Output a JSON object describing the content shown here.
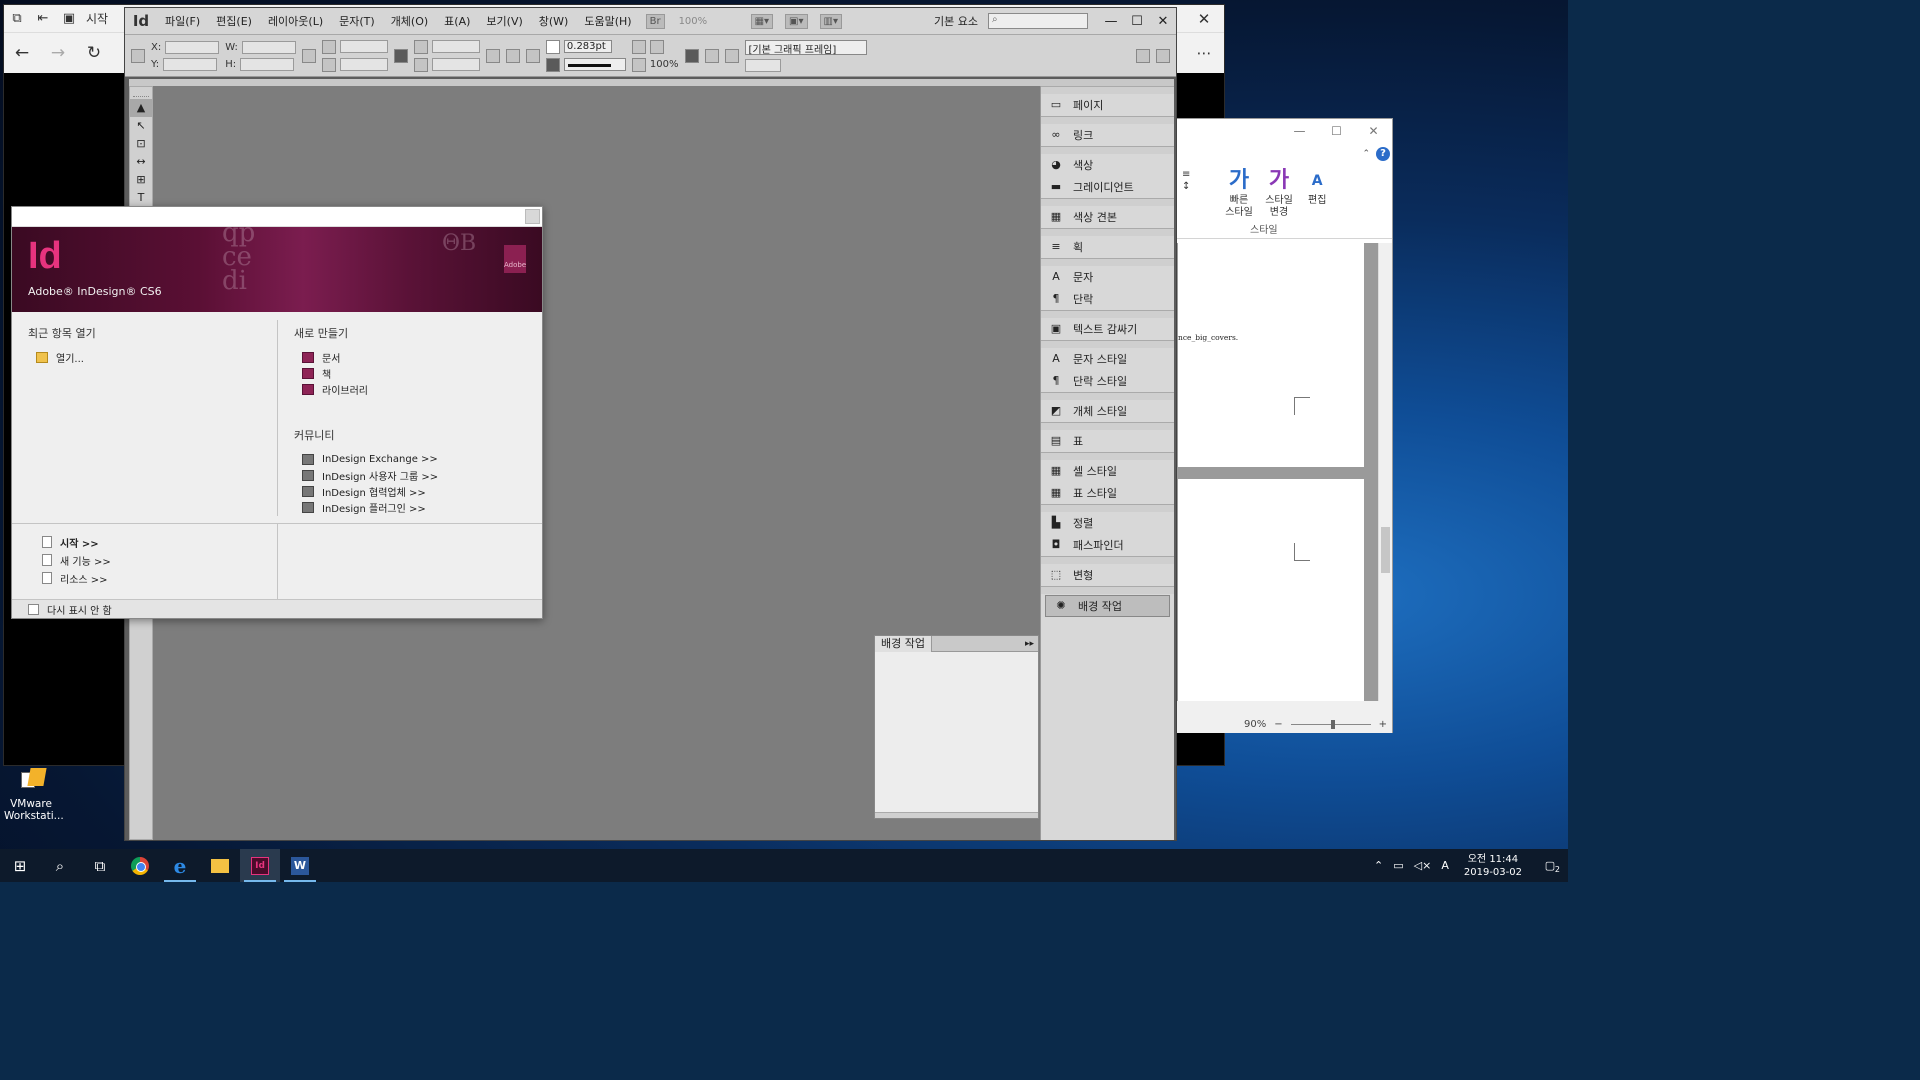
{
  "desktop": {
    "icon_label": "VMware Workstati..."
  },
  "edge": {
    "tab_title": "시작",
    "nav": {
      "back": "←",
      "forward": "→",
      "refresh": "↻",
      "more": "⋯"
    },
    "close": "✕"
  },
  "word": {
    "title_buttons": {
      "min": "—",
      "max": "☐",
      "close": "✕"
    },
    "ribbon": {
      "quick_styles": "빠른 스타일",
      "change_styles": "스타일 변경",
      "edit": "편집",
      "styles_group": "스타일",
      "quick_glyph": "가",
      "change_glyph": "가",
      "edit_glyph": "A"
    },
    "doc_text": "nce_big_covers.",
    "zoom": "90%",
    "zoom_out": "−",
    "zoom_in": "+"
  },
  "indesign": {
    "logo": "Id",
    "menu": [
      "파일(F)",
      "편집(E)",
      "레이아웃(L)",
      "문자(T)",
      "개체(O)",
      "표(A)",
      "보기(V)",
      "창(W)",
      "도움말(H)"
    ],
    "bridge_btn": "Br",
    "zoom_level": "100%",
    "workspace": "기본 요소",
    "search_placeholder": "",
    "window_buttons": {
      "min": "—",
      "max": "☐",
      "close": "✕"
    },
    "control": {
      "x_label": "X:",
      "y_label": "Y:",
      "w_label": "W:",
      "h_label": "H:",
      "stroke_weight": "0.283pt",
      "opacity": "100%",
      "frame_style": "[기본 그래픽 프레임]"
    },
    "tools": [
      "▲",
      "↖",
      "⊡",
      "↔",
      "⊞",
      "T"
    ],
    "panels": [
      {
        "label": "페이지",
        "icon": "pages-icon",
        "glyph": "▭"
      },
      {
        "label": "링크",
        "icon": "links-icon",
        "glyph": "∞"
      },
      {
        "label": "색상",
        "icon": "color-icon",
        "glyph": "◕"
      },
      {
        "label": "그레이디언트",
        "icon": "gradient-icon",
        "glyph": "▬"
      },
      {
        "label": "색상 견본",
        "icon": "swatches-icon",
        "glyph": "▦"
      },
      {
        "label": "획",
        "icon": "stroke-icon",
        "glyph": "≡"
      },
      {
        "label": "문자",
        "icon": "character-icon",
        "glyph": "A"
      },
      {
        "label": "단락",
        "icon": "paragraph-icon",
        "glyph": "¶"
      },
      {
        "label": "텍스트 감싸기",
        "icon": "text-wrap-icon",
        "glyph": "▣"
      },
      {
        "label": "문자 스타일",
        "icon": "character-styles-icon",
        "glyph": "A"
      },
      {
        "label": "단락 스타일",
        "icon": "paragraph-styles-icon",
        "glyph": "¶"
      },
      {
        "label": "개체 스타일",
        "icon": "object-styles-icon",
        "glyph": "◩"
      },
      {
        "label": "표",
        "icon": "table-icon",
        "glyph": "▤"
      },
      {
        "label": "셀 스타일",
        "icon": "cell-styles-icon",
        "glyph": "▦"
      },
      {
        "label": "표 스타일",
        "icon": "table-styles-icon",
        "glyph": "▦"
      },
      {
        "label": "정렬",
        "icon": "align-icon",
        "glyph": "▙"
      },
      {
        "label": "패스파인더",
        "icon": "pathfinder-icon",
        "glyph": "◘"
      },
      {
        "label": "변형",
        "icon": "transform-icon",
        "glyph": "⬚"
      },
      {
        "label": "배경 작업",
        "icon": "background-tasks-icon",
        "glyph": "✺"
      }
    ],
    "bg_panel_title": "배경 작업",
    "bg_panel_expand": "▸▸"
  },
  "welcome": {
    "logo": "Id",
    "product": "Adobe® InDesign® CS6",
    "adobe_mark": "Adobe",
    "recent_heading": "최근 항목 열기",
    "open_item": "열기...",
    "new_heading": "새로 만들기",
    "new_items": [
      "문서",
      "책",
      "라이브러리"
    ],
    "community_heading": "커뮤니티",
    "community_items": [
      "InDesign Exchange >>",
      "InDesign 사용자 그룹 >>",
      "InDesign 협력업체 >>",
      "InDesign 플러그인 >>"
    ],
    "bottom_items": [
      "시작 >>",
      "새 기능 >>",
      "리소스 >>"
    ],
    "dont_show": "다시 표시 안 함"
  },
  "taskbar": {
    "clock_time": "오전 11:44",
    "clock_date": "2019-03-02",
    "ime": "A",
    "notif_count": "2"
  }
}
